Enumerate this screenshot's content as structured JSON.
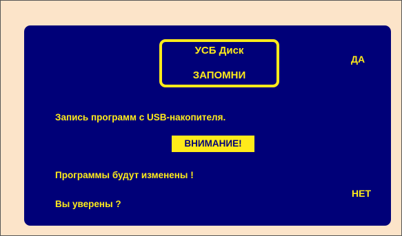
{
  "colors": {
    "page_background": "#FCE4C9",
    "screen_background": "#000078",
    "text": "#FFEB1A",
    "frame": "#FFEB1A",
    "warning_background": "#FFEB1A",
    "warning_text": "#000078"
  },
  "dialog": {
    "title_line1": "УСБ   Диск",
    "title_line2": "ЗАПОМНИ",
    "message": "Запись программ с USB-накопителя.",
    "warning": "ВНИМАНИЕ!",
    "notice": "Программы будут изменены !",
    "question": "Вы уверены ?",
    "yes_label": "ДА",
    "no_label": "НЕТ"
  }
}
